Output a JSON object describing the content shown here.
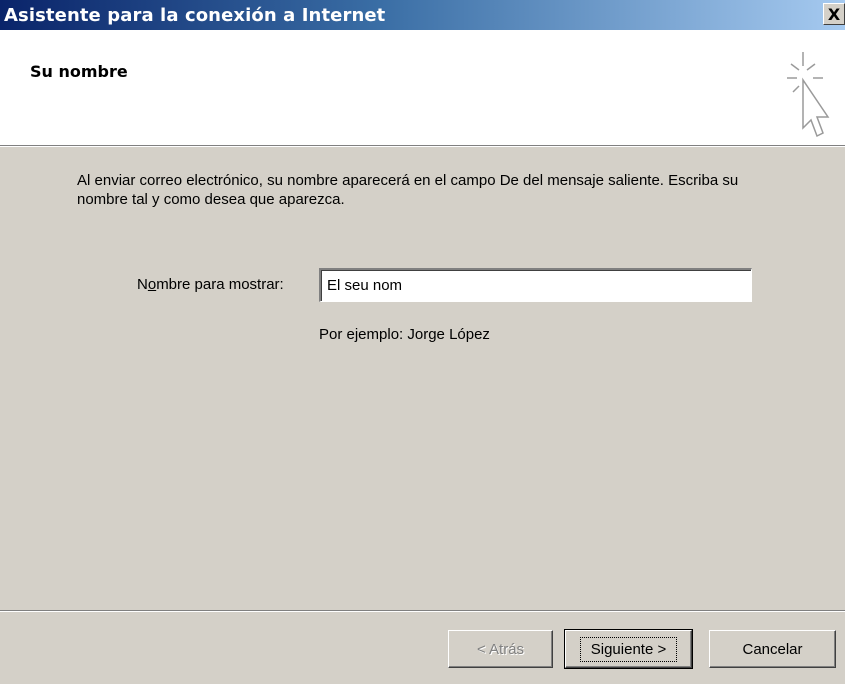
{
  "window": {
    "title": "Asistente para la conexión a Internet",
    "close_label": "X"
  },
  "header": {
    "title": "Su nombre",
    "icon": "wizard-cursor-icon"
  },
  "content": {
    "description": "Al enviar correo electrónico, su nombre aparecerá en el campo De del mensaje saliente. Escriba su nombre tal y como desea que aparezca.",
    "name_label_pre": "N",
    "name_label_accel": "o",
    "name_label_post": "mbre para mostrar:",
    "name_value": "El seu nom",
    "example": "Por ejemplo: Jorge López"
  },
  "buttons": {
    "back_label": "< Atrás",
    "next_label": "Siguiente >",
    "cancel_label": "Cancelar"
  },
  "colors": {
    "title_gradient_start": "#0a246a",
    "title_gradient_end": "#a6caf0",
    "dialog_face": "#d4d0c8",
    "header_bg": "#ffffff"
  }
}
